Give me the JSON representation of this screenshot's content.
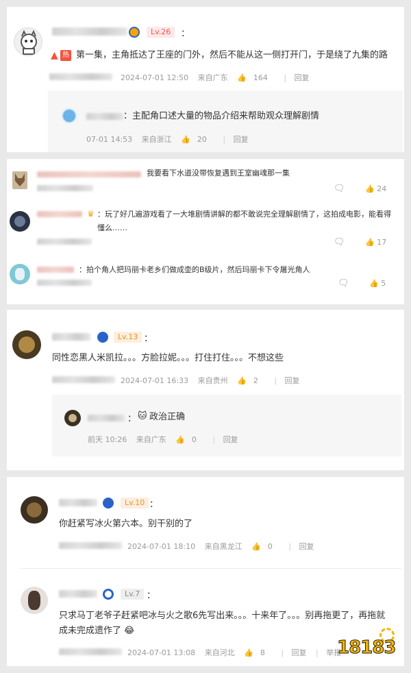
{
  "card1": {
    "level": "Lv.26",
    "hot_label": "热",
    "comment": "第一集，主角抵达了王座的门外，然后不能从这一侧打开门，于是绕了九集的路",
    "date": "2024-07-01 12:50",
    "location": "来自广东",
    "likes": "164",
    "reply_label": "回复",
    "reply": {
      "text": "：主配角口述大量的物品介绍来帮助观众理解剧情",
      "date": "07-01 14:53",
      "location": "来自浙江",
      "likes": "20",
      "reply_label": "回复"
    }
  },
  "card2": {
    "items": [
      {
        "text": "我要看下水道没带恢复遇到王室幽魂那一集",
        "count": "24"
      },
      {
        "text": "：玩了好几遍游戏看了一大堆剧情讲解的都不敢说完全理解剧情了，这拍成电影，能看得懂么……",
        "count": "17"
      },
      {
        "text": "：拍个角人把玛丽卡老乡们做成壶的B级片，然后玛丽卡下令屠光角人",
        "count": "5"
      }
    ]
  },
  "card3": {
    "level": "Lv.13",
    "comment": "同性恋黑人米凯拉。。。方脸拉妮。。。打住打住。。。不想这些",
    "date": "2024-07-01 16:33",
    "location": "来自贵州",
    "likes": "2",
    "reply_label": "回复",
    "reply": {
      "text": "政治正确",
      "date": "前天 10:26",
      "location": "来自广东",
      "likes": "0",
      "reply_label": "回复"
    }
  },
  "card4": {
    "c1": {
      "level": "Lv.10",
      "comment": "你赶紧写冰火第六本。别干别的了",
      "date": "2024-07-01 18:10",
      "location": "来自黑龙江",
      "likes": "0",
      "reply_label": "回复"
    },
    "c2": {
      "level": "Lv.7",
      "comment_line1": "只求马丁老爷子赶紧吧冰与火之歌6先写出来。。。十来年了。。。别再拖更了，再拖就",
      "comment_line2": "成未完成遗作了",
      "date": "2024-07-01 13:08",
      "location": "来自河北",
      "likes": "8",
      "reply_label": "回复",
      "report_label": "举报"
    }
  },
  "watermark": "18183"
}
